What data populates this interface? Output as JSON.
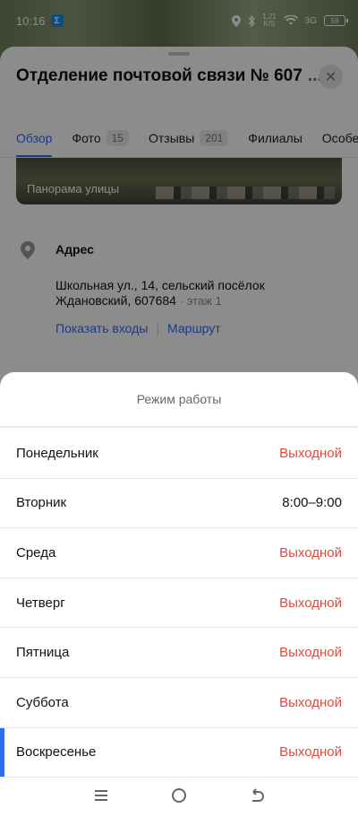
{
  "status_bar": {
    "time": "10:16",
    "app_badge": "Σ",
    "net_speed": "1,21",
    "net_unit": "K/S",
    "signal": "3G",
    "battery": "59"
  },
  "place": {
    "title": "Отделение почтовой связи № 607",
    "more": "..."
  },
  "tabs": [
    {
      "label": "Обзор",
      "count": null
    },
    {
      "label": "Фото",
      "count": "15"
    },
    {
      "label": "Отзывы",
      "count": "201"
    },
    {
      "label": "Филиалы",
      "count": null
    },
    {
      "label": "Особен",
      "count": null
    }
  ],
  "panorama": {
    "label": "Панорама улицы"
  },
  "address": {
    "title": "Адрес",
    "text": "Школьная ул., 14, сельский посёлок Ждановский, 607684",
    "floor": "· этаж 1",
    "show_entrances": "Показать входы",
    "separator": "|",
    "route": "Маршрут"
  },
  "schedule": {
    "title": "Режим работы",
    "days": [
      {
        "day": "Понедельник",
        "hours": "Выходной",
        "closed": true,
        "today": false
      },
      {
        "day": "Вторник",
        "hours": "8:00–9:00",
        "closed": false,
        "today": false
      },
      {
        "day": "Среда",
        "hours": "Выходной",
        "closed": true,
        "today": false
      },
      {
        "day": "Четверг",
        "hours": "Выходной",
        "closed": true,
        "today": false
      },
      {
        "day": "Пятница",
        "hours": "Выходной",
        "closed": true,
        "today": false
      },
      {
        "day": "Суббота",
        "hours": "Выходной",
        "closed": true,
        "today": false
      },
      {
        "day": "Воскресенье",
        "hours": "Выходной",
        "closed": true,
        "today": true
      }
    ]
  },
  "colors": {
    "accent": "#3369f5",
    "closed": "#e2483c",
    "today_marker": "#2f6bf5"
  },
  "nav_icons": [
    "menu-icon",
    "home-circle-icon",
    "back-icon"
  ]
}
